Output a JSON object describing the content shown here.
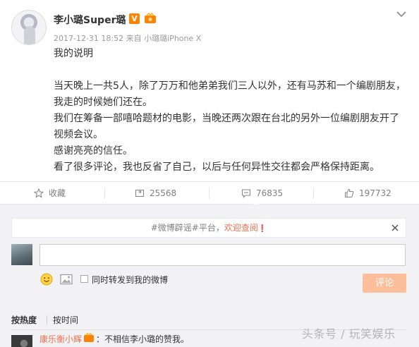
{
  "post": {
    "username": "李小璐Super璐",
    "verified_badge": "V",
    "timestamp": "2017-12-31 18:52 来自 小璐璐",
    "device": "iPhone X",
    "paragraphs": [
      "我的说明",
      "",
      "当天晚上一共5人，除了万万和他弟弟我们三人以外，还有马苏和一个编剧朋友，",
      "我走的时候她们还在。",
      "我们在筹备一部嘻哈题材的电影，当晚还两次跟在台北的另外一位编剧朋友开了",
      "视频会议。",
      "感谢亮亮的信任。",
      "看了很多评论，我也反省了自己，以后与任何异性交往都会严格保持距离。"
    ]
  },
  "actions": {
    "favorite_label": "收藏",
    "repost_count": "25568",
    "comment_count": "76835",
    "like_count": "197732"
  },
  "comments": {
    "notice_text": "#微博辟谣#平台，",
    "notice_link": "欢迎查阅",
    "notice_mark": "❗",
    "also_repost_label": "同时转发到我的微博",
    "submit_label": "评论",
    "sort_hot": "按热度",
    "sort_time": "按时间",
    "first_comment": {
      "user": "康乐衡小辉",
      "text": "：不相信李小璐的赞我。"
    }
  },
  "watermark": "头条号 / 玩笑娱乐",
  "colors": {
    "accent_orange": "#eb7350",
    "submit_disabled": "#fdbf9b",
    "verified": "#ff8200",
    "comment_bg": "#f2f2f5"
  },
  "icons": [
    "avatar",
    "verified-icon",
    "member-icon",
    "chevron-down-icon",
    "star-icon",
    "repost-icon",
    "comment-icon",
    "like-icon",
    "close-icon",
    "emoji-icon",
    "picture-icon"
  ]
}
